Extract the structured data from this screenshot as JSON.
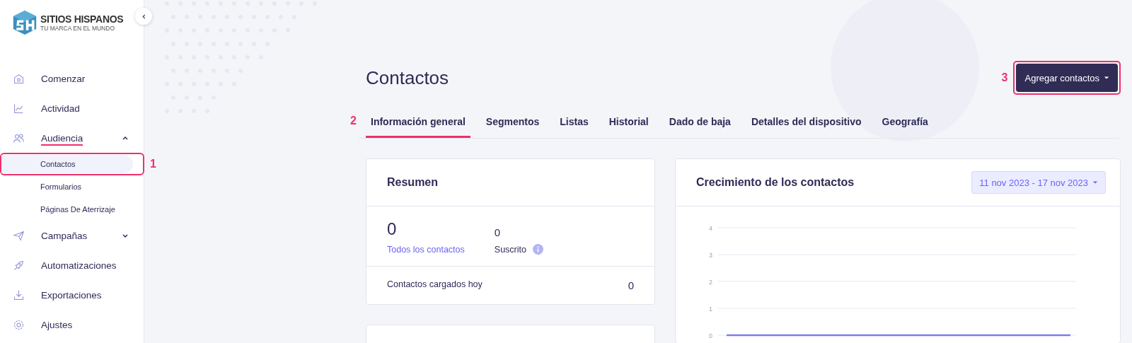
{
  "brand": {
    "name": "SITIOS HISPANOS",
    "tagline": "TU MARCA EN EL MUNDO"
  },
  "sidebar": {
    "items": [
      {
        "label": "Comenzar",
        "selected": false
      },
      {
        "label": "Actividad",
        "selected": false
      },
      {
        "label": "Audiencia",
        "selected": true,
        "expanded": true,
        "children": [
          {
            "label": "Contactos",
            "selected": true,
            "callout": "1"
          },
          {
            "label": "Formularios",
            "selected": false
          },
          {
            "label": "Páginas De Aterrizaje",
            "selected": false
          }
        ]
      },
      {
        "label": "Campañas",
        "selected": false,
        "expanded": false
      },
      {
        "label": "Automatizaciones",
        "selected": false
      },
      {
        "label": "Exportaciones",
        "selected": false
      },
      {
        "label": "Ajustes",
        "selected": false
      }
    ]
  },
  "page": {
    "title": "Contactos",
    "action": {
      "label": "Agregar contactos",
      "callout": "3"
    }
  },
  "tabs": {
    "callout": "2",
    "items": [
      {
        "label": "Información general",
        "selected": true
      },
      {
        "label": "Segmentos",
        "selected": false
      },
      {
        "label": "Listas",
        "selected": false
      },
      {
        "label": "Historial",
        "selected": false
      },
      {
        "label": "Dado de baja",
        "selected": false
      },
      {
        "label": "Detalles del dispositivo",
        "selected": false
      },
      {
        "label": "Geografía",
        "selected": false
      }
    ]
  },
  "summary": {
    "title": "Resumen",
    "stats": [
      {
        "value": "0",
        "label": "Todos los contactos",
        "kind": "link"
      },
      {
        "value": "0",
        "label": "Suscrito",
        "kind": "info"
      }
    ],
    "today": {
      "label": "Contactos cargados hoy",
      "value": "0"
    }
  },
  "growth": {
    "title": "Crecimiento de los contactos",
    "date_range": "11 nov 2023 - 17 nov 2023",
    "chart_data": {
      "type": "line",
      "grid": true,
      "ylim": [
        0,
        4
      ],
      "yticks": [
        0,
        1,
        2,
        3,
        4
      ],
      "series": [
        {
          "color": "#7b7bf0",
          "values": [
            0,
            0,
            0,
            0,
            0,
            0,
            0
          ]
        }
      ]
    }
  }
}
